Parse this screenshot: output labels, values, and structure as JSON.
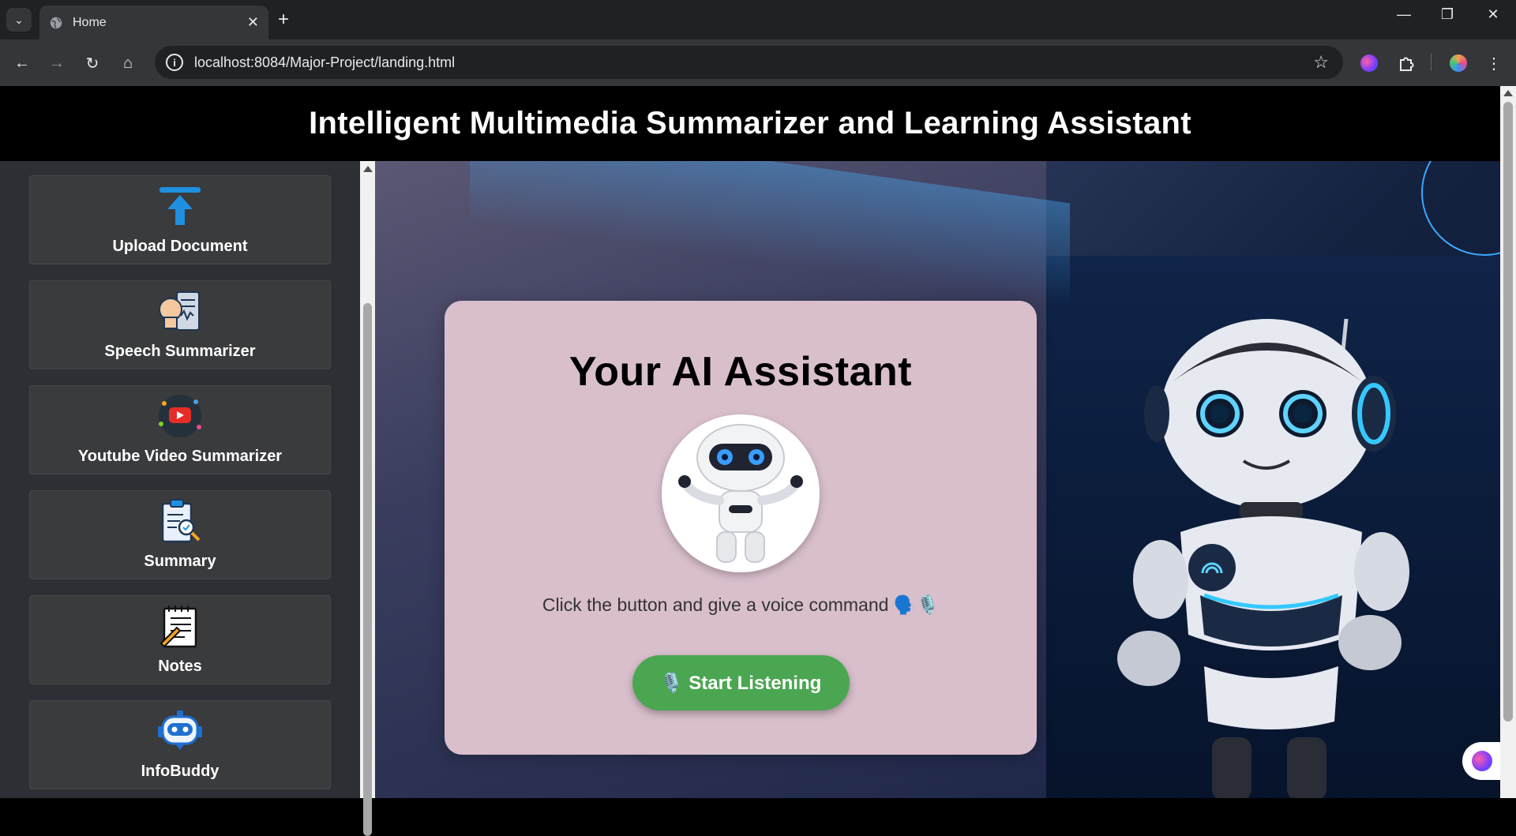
{
  "browser": {
    "tab_title": "Home",
    "url": "localhost:8084/Major-Project/landing.html",
    "icons": [
      "tab-list-icon",
      "globe-icon",
      "close-icon",
      "plus-icon",
      "minimize-icon",
      "restore-icon",
      "window-close-icon",
      "back-icon",
      "forward-icon",
      "reload-icon",
      "home-icon",
      "info-icon",
      "star-icon",
      "brain-extension-icon",
      "puzzle-icon",
      "profile-avatar"
    ]
  },
  "header": {
    "title": "Intelligent Multimedia Summarizer and Learning Assistant"
  },
  "sidebar": {
    "items": [
      {
        "label": "Upload Document",
        "icon": "upload-icon"
      },
      {
        "label": "Speech Summarizer",
        "icon": "speech-icon"
      },
      {
        "label": "Youtube Video Summarizer",
        "icon": "youtube-icon"
      },
      {
        "label": "Summary",
        "icon": "clipboard-search-icon"
      },
      {
        "label": "Notes",
        "icon": "notepad-icon"
      },
      {
        "label": "InfoBuddy",
        "icon": "chatbot-icon"
      }
    ]
  },
  "assistant": {
    "title": "Your AI Assistant",
    "hint": "Click the button and give a voice command 🗣️🎙️",
    "button_label": "🎙️ Start Listening"
  },
  "colors": {
    "header_bg": "#000000",
    "sidebar_bg": "#2c2f33",
    "card_bg": "#d9bfcc",
    "button_green": "#4aa651"
  }
}
